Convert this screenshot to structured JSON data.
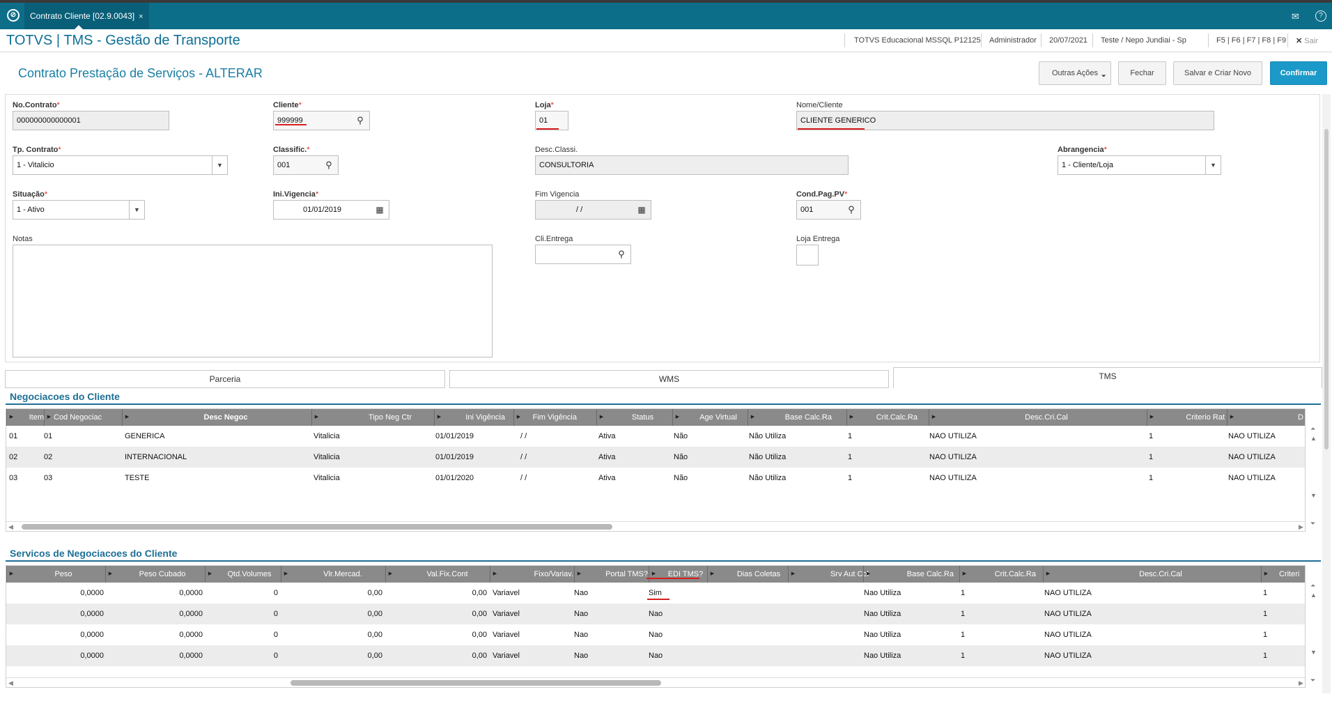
{
  "topbar": {
    "tab_label": "Contrato Cliente [02.9.0043]",
    "tab_close": "×",
    "mail_icon": "✉",
    "help_icon": "?"
  },
  "appbar": {
    "title": "TOTVS | TMS - Gestão de Transporte",
    "environment": "TOTVS Educacional MSSQL P12125",
    "user": "Administrador",
    "date": "20/07/2021",
    "branch": "Teste / Nepo Jundiai - Sp",
    "shortcuts": "F5 | F6 | F7 | F8 | F9",
    "exit": "Sair"
  },
  "page": {
    "title": "Contrato Prestação de Serviços - ALTERAR"
  },
  "actions": {
    "more": "Outras Ações",
    "close": "Fechar",
    "save_new": "Salvar e Criar Novo",
    "confirm": "Confirmar"
  },
  "form": {
    "no_contrato": {
      "label": "No.Contrato",
      "value": "000000000000001"
    },
    "cliente": {
      "label": "Cliente",
      "value": "999999"
    },
    "loja": {
      "label": "Loja",
      "value": "01"
    },
    "nome_cliente": {
      "label": "Nome/Cliente",
      "value": "CLIENTE GENERICO"
    },
    "tp_contrato": {
      "label": "Tp. Contrato",
      "value": "1 - Vitalicio"
    },
    "classific": {
      "label": "Classific.",
      "value": "001"
    },
    "desc_classi": {
      "label": "Desc.Classi.",
      "value": "CONSULTORIA"
    },
    "abrangencia": {
      "label": "Abrangencia",
      "value": "1 - Cliente/Loja"
    },
    "situacao": {
      "label": "Situação",
      "value": "1 - Ativo"
    },
    "ini_vigencia": {
      "label": "Ini.Vigencia",
      "value": "01/01/2019"
    },
    "fim_vigencia": {
      "label": "Fim Vigencia",
      "value": "/ /"
    },
    "cond_pag": {
      "label": "Cond.Pag.PV",
      "value": "001"
    },
    "notas": {
      "label": "Notas",
      "value": ""
    },
    "cli_entrega": {
      "label": "Cli.Entrega",
      "value": ""
    },
    "loja_entrega": {
      "label": "Loja Entrega",
      "value": ""
    }
  },
  "tabs": [
    "Parceria",
    "WMS",
    "TMS"
  ],
  "negociacoes": {
    "title": "Negociacoes do Cliente",
    "columns": [
      "Item",
      "Cod Negociac",
      "Desc Negoc",
      "Tipo Neg Ctr",
      "Ini Vigência",
      "Fim Vigência",
      "Status",
      "Age Virtual",
      "Base Calc.Ra",
      "Crit.Calc.Ra",
      "Desc.Cri.Cal",
      "Criterio Rat",
      "D"
    ],
    "rows": [
      [
        "01",
        "01",
        "GENERICA",
        "Vitalicia",
        "01/01/2019",
        "/ /",
        "Ativa",
        "Não",
        "Não Utiliza",
        "1",
        "NAO UTILIZA",
        "1",
        "NAO UTILIZA"
      ],
      [
        "02",
        "02",
        "INTERNACIONAL",
        "Vitalicia",
        "01/01/2019",
        "/ /",
        "Ativa",
        "Não",
        "Não Utiliza",
        "1",
        "NAO UTILIZA",
        "1",
        "NAO UTILIZA"
      ],
      [
        "03",
        "03",
        "TESTE",
        "Vitalicia",
        "01/01/2020",
        "/ /",
        "Ativa",
        "Não",
        "Não Utiliza",
        "1",
        "NAO UTILIZA",
        "1",
        "NAO UTILIZA"
      ]
    ]
  },
  "servicos": {
    "title": "Servicos de Negociacoes do Cliente",
    "columns": [
      "Peso",
      "Peso Cubado",
      "Qtd.Volumes",
      "Vlr.Mercad.",
      "Val.Fix.Cont",
      "Fixo/Variav.",
      "Portal TMS?",
      "EDI TMS?",
      "Dias Coletas",
      "Srv Aut Col",
      "Base Calc.Ra",
      "Crit.Calc.Ra",
      "Desc.Cri.Cal",
      "Criteri"
    ],
    "rows": [
      [
        "0,0000",
        "0,0000",
        "0",
        "0,00",
        "0,00",
        "Variavel",
        "Nao",
        "Sim",
        "",
        "",
        "Nao Utiliza",
        "1",
        "NAO UTILIZA",
        "1"
      ],
      [
        "0,0000",
        "0,0000",
        "0",
        "0,00",
        "0,00",
        "Variavel",
        "Nao",
        "Nao",
        "",
        "",
        "Nao Utiliza",
        "1",
        "NAO UTILIZA",
        "1"
      ],
      [
        "0,0000",
        "0,0000",
        "0",
        "0,00",
        "0,00",
        "Variavel",
        "Nao",
        "Nao",
        "",
        "",
        "Nao Utiliza",
        "1",
        "NAO UTILIZA",
        "1"
      ],
      [
        "0,0000",
        "0,0000",
        "0",
        "0,00",
        "0,00",
        "Variavel",
        "Nao",
        "Nao",
        "",
        "",
        "Nao Utiliza",
        "1",
        "NAO UTILIZA",
        "1"
      ]
    ]
  },
  "colors": {
    "brand": "#0d6e8a",
    "accent": "#1b99c9",
    "required": "#e0201c",
    "highlight": "#d81e1e"
  }
}
